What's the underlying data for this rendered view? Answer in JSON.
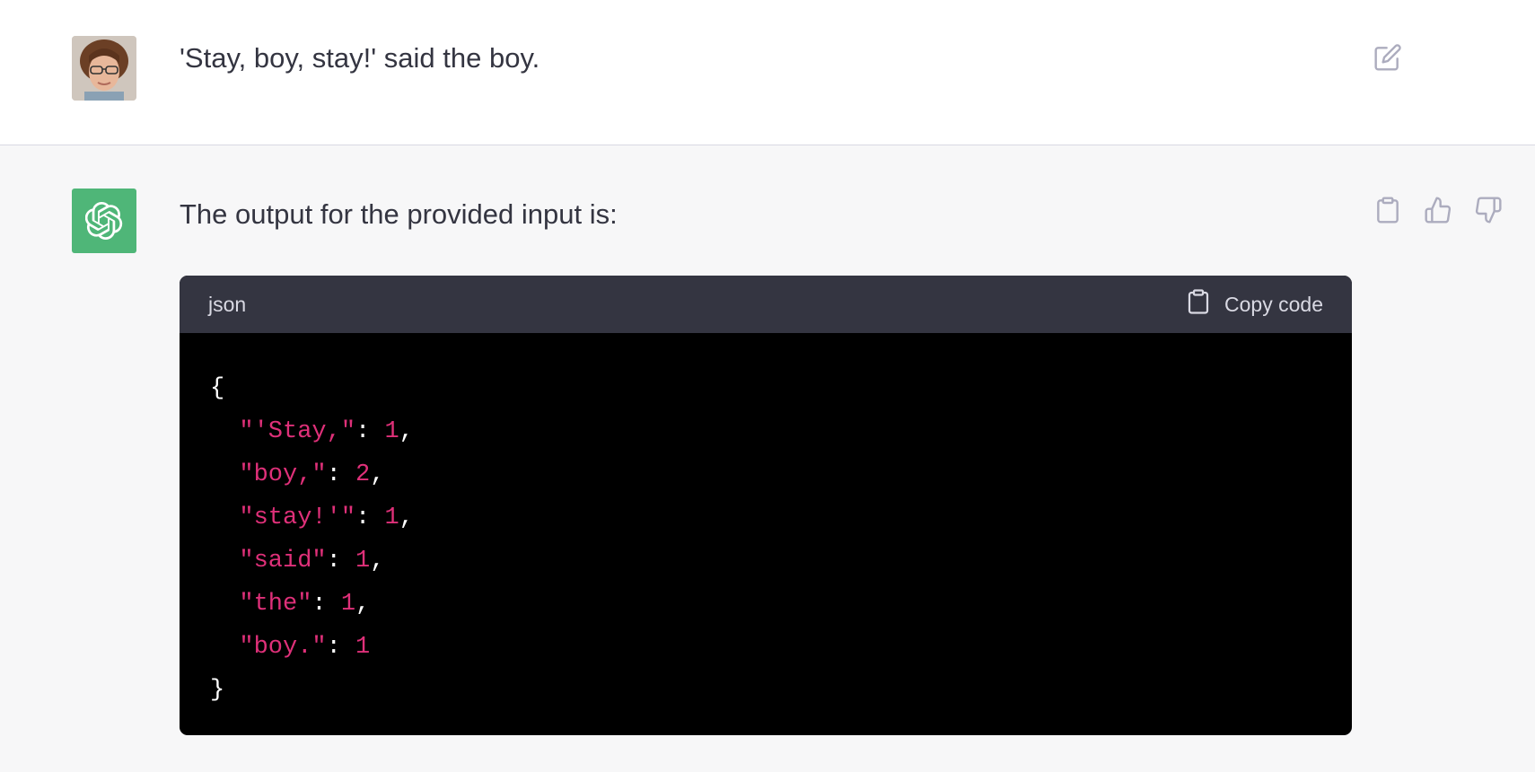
{
  "user_message": {
    "text": "'Stay, boy, stay!' said the boy."
  },
  "assistant_message": {
    "intro": "The output for the provided input is:",
    "code_block": {
      "language": "json",
      "copy_label": "Copy code",
      "open_brace": "{",
      "close_brace": "}",
      "entries": [
        {
          "key": "\"'Stay,\"",
          "value": "1",
          "comma": ","
        },
        {
          "key": "\"boy,\"",
          "value": "2",
          "comma": ","
        },
        {
          "key": "\"stay!'\"",
          "value": "1",
          "comma": ","
        },
        {
          "key": "\"said\"",
          "value": "1",
          "comma": ","
        },
        {
          "key": "\"the\"",
          "value": "1",
          "comma": ","
        },
        {
          "key": "\"boy.\"",
          "value": "1",
          "comma": ""
        }
      ]
    }
  },
  "icons": {
    "edit": "edit-icon",
    "copy": "clipboard-icon",
    "thumbs_up": "thumbs-up-icon",
    "thumbs_down": "thumbs-down-icon",
    "assistant_logo": "openai-logo-icon"
  },
  "colors": {
    "assistant_avatar_bg": "#4fb678",
    "code_string": "#df3079",
    "code_header_bg": "#343541",
    "code_bg": "#000000"
  }
}
